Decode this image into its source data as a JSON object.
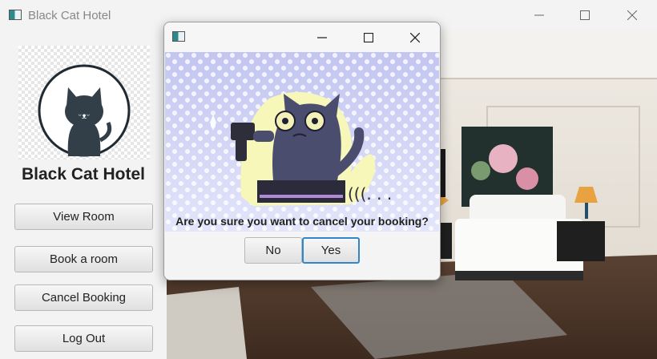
{
  "window": {
    "title": "Black Cat Hotel"
  },
  "sidebar": {
    "hotel_name": "Black Cat Hotel",
    "buttons": [
      "View Room",
      "Book a room",
      "Cancel Booking",
      "Log Out"
    ]
  },
  "dialog": {
    "title": "",
    "message": "Are you sure you want to cancel your booking?",
    "no_label": "No",
    "yes_label": "Yes",
    "ellipsis_text": "(((. . ."
  },
  "colors": {
    "focus_border": "#2f86c8",
    "cat": "#3b3b4f",
    "dialog_sky": "#c9ccf2"
  },
  "icons": [
    "app-icon",
    "minimize-icon",
    "maximize-icon",
    "close-icon"
  ]
}
